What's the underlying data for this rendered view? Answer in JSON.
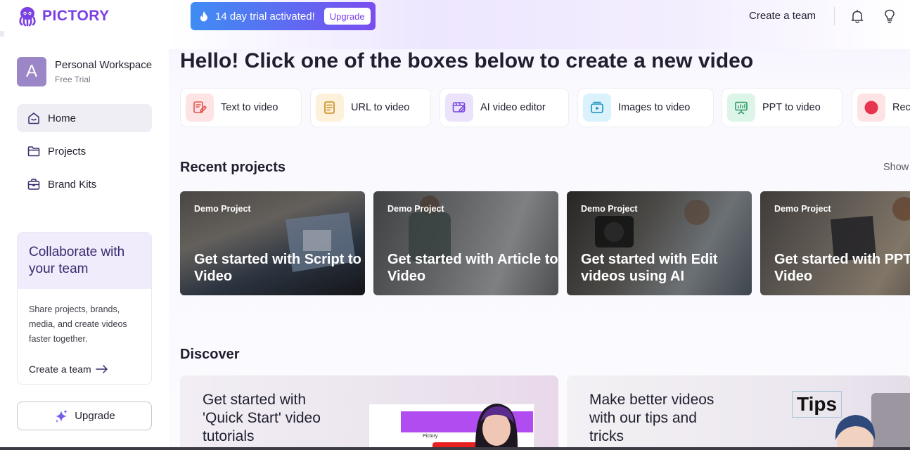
{
  "brand": {
    "name": "PICTORY"
  },
  "workspace": {
    "avatar_letter": "A",
    "name": "Personal Workspace",
    "plan": "Free Trial"
  },
  "nav": {
    "items": [
      {
        "label": "Home",
        "icon": "home-icon",
        "active": true
      },
      {
        "label": "Projects",
        "icon": "folder-icon",
        "active": false
      },
      {
        "label": "Brand Kits",
        "icon": "briefcase-icon",
        "active": false
      }
    ]
  },
  "collab": {
    "title": "Collaborate with your team",
    "body": "Share projects, brands, media, and create videos faster together.",
    "link": "Create a team"
  },
  "sidebar_upgrade": "Upgrade",
  "topbar": {
    "trial_text": "14 day trial activated!",
    "trial_upgrade": "Upgrade",
    "create_team": "Create a team"
  },
  "hero": {
    "title": "Hello! Click one of the boxes below to create a new video"
  },
  "tools": [
    {
      "label": "Text to video",
      "icon": "text-edit-icon",
      "bg": "#fde3e3",
      "fg": "#e2544f"
    },
    {
      "label": "URL to video",
      "icon": "document-icon",
      "bg": "#fdf1dc",
      "fg": "#c98a1a"
    },
    {
      "label": "AI video editor",
      "icon": "video-edit-icon",
      "bg": "#ebe2fb",
      "fg": "#7a4ae0"
    },
    {
      "label": "Images to video",
      "icon": "image-play-icon",
      "bg": "#d9f2fb",
      "fg": "#1b8fc2"
    },
    {
      "label": "PPT to video",
      "icon": "presentation-icon",
      "bg": "#dcf5e8",
      "fg": "#2a9a63"
    },
    {
      "label": "Reco",
      "icon": "record-icon",
      "bg": "#fde3e3",
      "fg": "#e8344e"
    }
  ],
  "recent": {
    "title": "Recent projects",
    "show_all": "Show",
    "projects": [
      {
        "tag": "Demo Project",
        "title": "Get started with Script to Video"
      },
      {
        "tag": "Demo Project",
        "title": "Get started with Article to Video"
      },
      {
        "tag": "Demo Project",
        "title": "Get started with Edit videos using AI"
      },
      {
        "tag": "Demo Project",
        "title": "Get started with PPT to Video"
      }
    ]
  },
  "discover": {
    "title": "Discover",
    "cards": [
      {
        "title": "Get started with 'Quick Start' video tutorials",
        "thumb_label": "Pictory"
      },
      {
        "title": "Make better videos with our tips and tricks",
        "thumb_label": "Tips"
      }
    ]
  }
}
